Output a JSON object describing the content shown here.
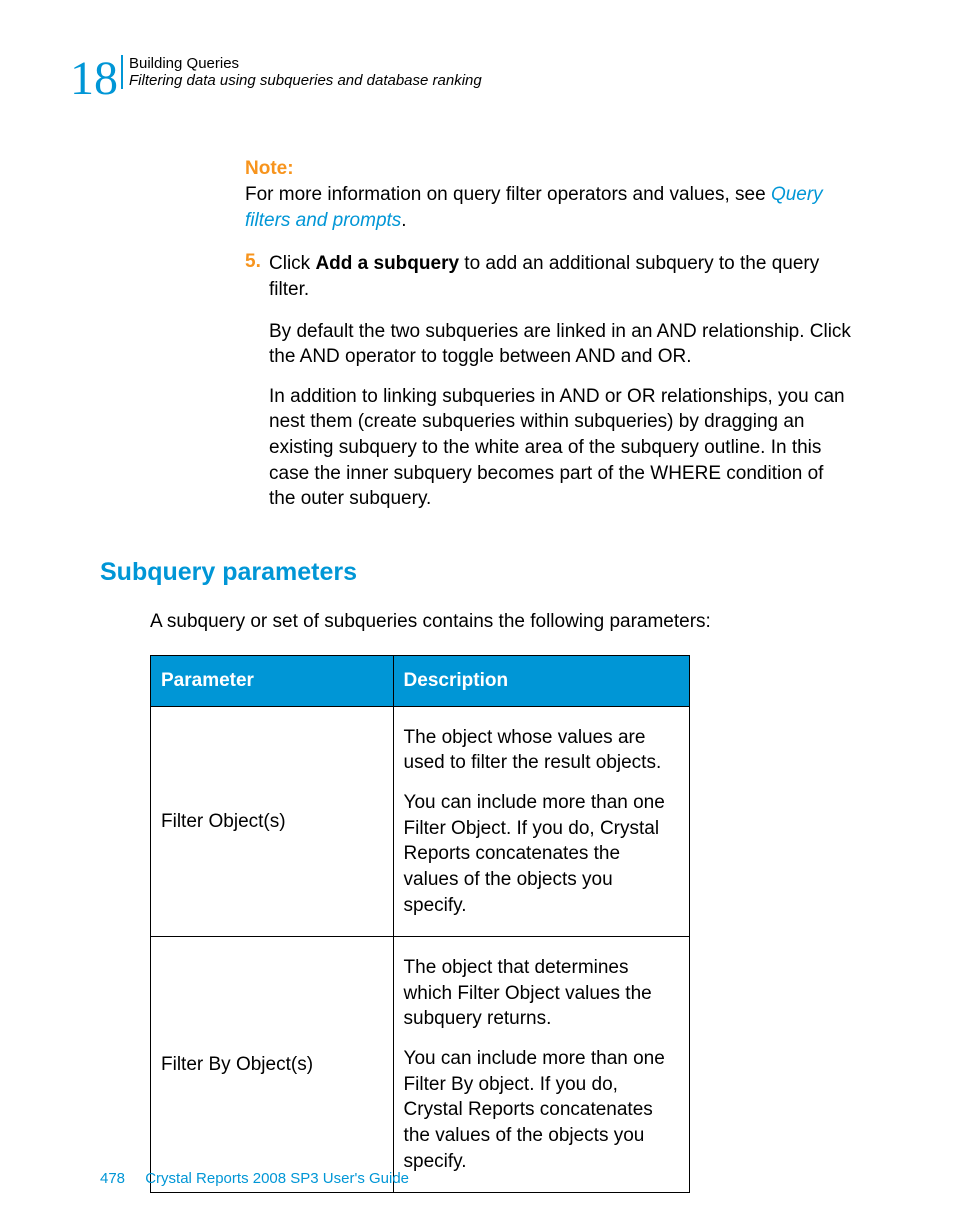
{
  "header": {
    "chapter_number": "18",
    "title": "Building Queries",
    "subtitle": "Filtering data using subqueries and database ranking"
  },
  "note": {
    "label": "Note:",
    "prefix": "For more information on query filter operators and values, see ",
    "link": "Query filters and prompts",
    "suffix": "."
  },
  "step": {
    "number": "5.",
    "text_a": "Click ",
    "text_bold": "Add a subquery",
    "text_b": " to add an additional subquery to the query filter.",
    "para1": "By default the two subqueries are linked in an AND relationship. Click the AND operator to toggle between AND and OR.",
    "para2": "In addition to linking subqueries in AND or OR relationships, you can nest them (create subqueries within subqueries) by dragging an existing subquery to the white area of the subquery outline. In this case the inner subquery becomes part of the WHERE condition of the outer subquery."
  },
  "section": {
    "heading": "Subquery parameters",
    "intro": "A subquery or set of subqueries contains the following parameters:"
  },
  "table": {
    "headers": {
      "param": "Parameter",
      "desc": "Description"
    },
    "rows": [
      {
        "param": "Filter Object(s)",
        "desc1": "The object whose values are used to filter the result objects.",
        "desc2": "You can include more than one Filter Object. If you do, Crystal Reports concatenates the values of the objects you specify."
      },
      {
        "param": "Filter By Object(s)",
        "desc1": "The object that determines which Filter Object values the subquery returns.",
        "desc2": "You can include more than one Filter By object. If you do, Crystal Reports concatenates the values of the objects you specify."
      }
    ]
  },
  "footer": {
    "page": "478",
    "title": "Crystal Reports 2008 SP3 User's Guide"
  }
}
